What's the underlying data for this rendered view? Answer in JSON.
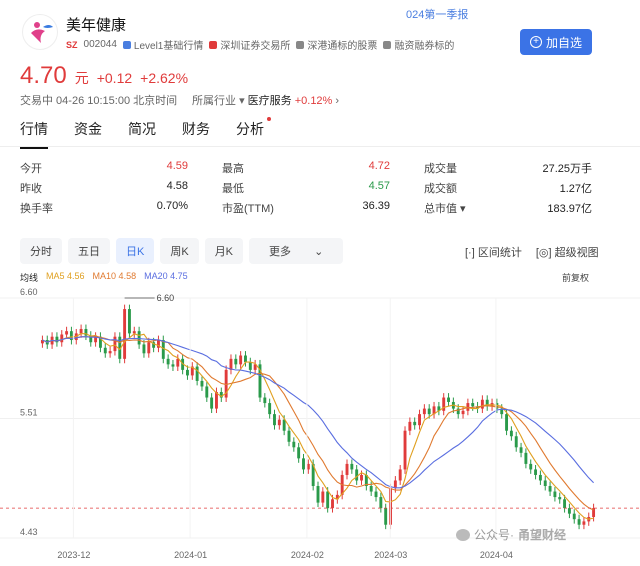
{
  "header": {
    "title": "美年健康",
    "exchange": "SZ",
    "code": "002044",
    "tags": [
      "Level1基础行情",
      "深圳证券交易所",
      "深港通标的股票",
      "融资融券标的"
    ],
    "report_link": "024第一季报",
    "add_button": "加自选"
  },
  "quote": {
    "price": "4.70",
    "unit": "元",
    "change": "+0.12",
    "change_pct": "+2.62%",
    "trade_info": "交易中 04-26 10:15:00 北京时间",
    "industry_label": "所属行业",
    "industry": "医疗服务",
    "industry_pct": "+0.12%"
  },
  "tabs": [
    "行情",
    "资金",
    "简况",
    "财务",
    "分析"
  ],
  "stats": [
    [
      [
        "今开",
        "4.59",
        "#e03b3b"
      ],
      [
        "最高",
        "4.72",
        "#e03b3b"
      ],
      [
        "成交量",
        "27.25万手",
        "#222"
      ]
    ],
    [
      [
        "昨收",
        "4.58",
        "#222"
      ],
      [
        "最低",
        "4.57",
        "#2a9a4a"
      ],
      [
        "成交额",
        "1.27亿",
        "#222"
      ]
    ],
    [
      [
        "换手率",
        "0.70%",
        "#222"
      ],
      [
        "市盈(TTM)",
        "36.39",
        "#222"
      ],
      [
        "总市值 ▾",
        "183.97亿",
        "#222"
      ]
    ]
  ],
  "ranges": [
    "分时",
    "五日",
    "日K",
    "周K",
    "月K",
    "更多"
  ],
  "tools": {
    "interval_stat": "区间统计",
    "super_view": "超级视图"
  },
  "legend": {
    "base": "均线",
    "ma5": "MA5 4.56",
    "ma10": "MA10 4.58",
    "ma20": "MA20 4.75",
    "adjust": "前复权"
  },
  "watermark": {
    "wechat": "公众号·",
    "name": "甬望财经"
  },
  "colors": {
    "up": "#e03b3b",
    "down": "#2a9a4a",
    "ma5": "#e0a020",
    "ma10": "#e07a30",
    "ma20": "#5a6ee0",
    "accent": "#3b73e6"
  },
  "chart_data": {
    "type": "candlestick",
    "y_ticks": [
      "6.60",
      "5.51",
      "4.43"
    ],
    "ylim": [
      4.43,
      6.6
    ],
    "x_ticks": [
      "2023-12",
      "2024-01",
      "2024-02",
      "2024-03",
      "2024-04"
    ],
    "annotation": "6.60",
    "closes": [
      6.22,
      6.18,
      6.25,
      6.2,
      6.27,
      6.3,
      6.22,
      6.28,
      6.32,
      6.26,
      6.2,
      6.25,
      6.15,
      6.1,
      6.12,
      6.25,
      6.05,
      6.5,
      6.28,
      6.3,
      6.18,
      6.1,
      6.2,
      6.15,
      6.22,
      6.05,
      6.0,
      5.98,
      6.05,
      5.95,
      5.9,
      5.98,
      5.85,
      5.8,
      5.7,
      5.6,
      5.75,
      5.7,
      5.95,
      6.05,
      6.0,
      6.08,
      6.02,
      5.95,
      6.0,
      5.7,
      5.65,
      5.55,
      5.45,
      5.5,
      5.4,
      5.3,
      5.25,
      5.15,
      5.05,
      5.1,
      4.9,
      4.75,
      4.85,
      4.7,
      4.78,
      4.82,
      5.0,
      5.1,
      5.05,
      4.95,
      5.0,
      4.9,
      4.85,
      4.8,
      4.7,
      4.55,
      4.88,
      4.95,
      5.05,
      5.4,
      5.48,
      5.45,
      5.55,
      5.6,
      5.55,
      5.62,
      5.58,
      5.7,
      5.66,
      5.6,
      5.55,
      5.58,
      5.65,
      5.62,
      5.6,
      5.68,
      5.62,
      5.65,
      5.6,
      5.55,
      5.4,
      5.35,
      5.25,
      5.2,
      5.1,
      5.05,
      5.0,
      4.95,
      4.9,
      4.85,
      4.8,
      4.78,
      4.7,
      4.65,
      4.6,
      4.55,
      4.58,
      4.62,
      4.7
    ]
  }
}
